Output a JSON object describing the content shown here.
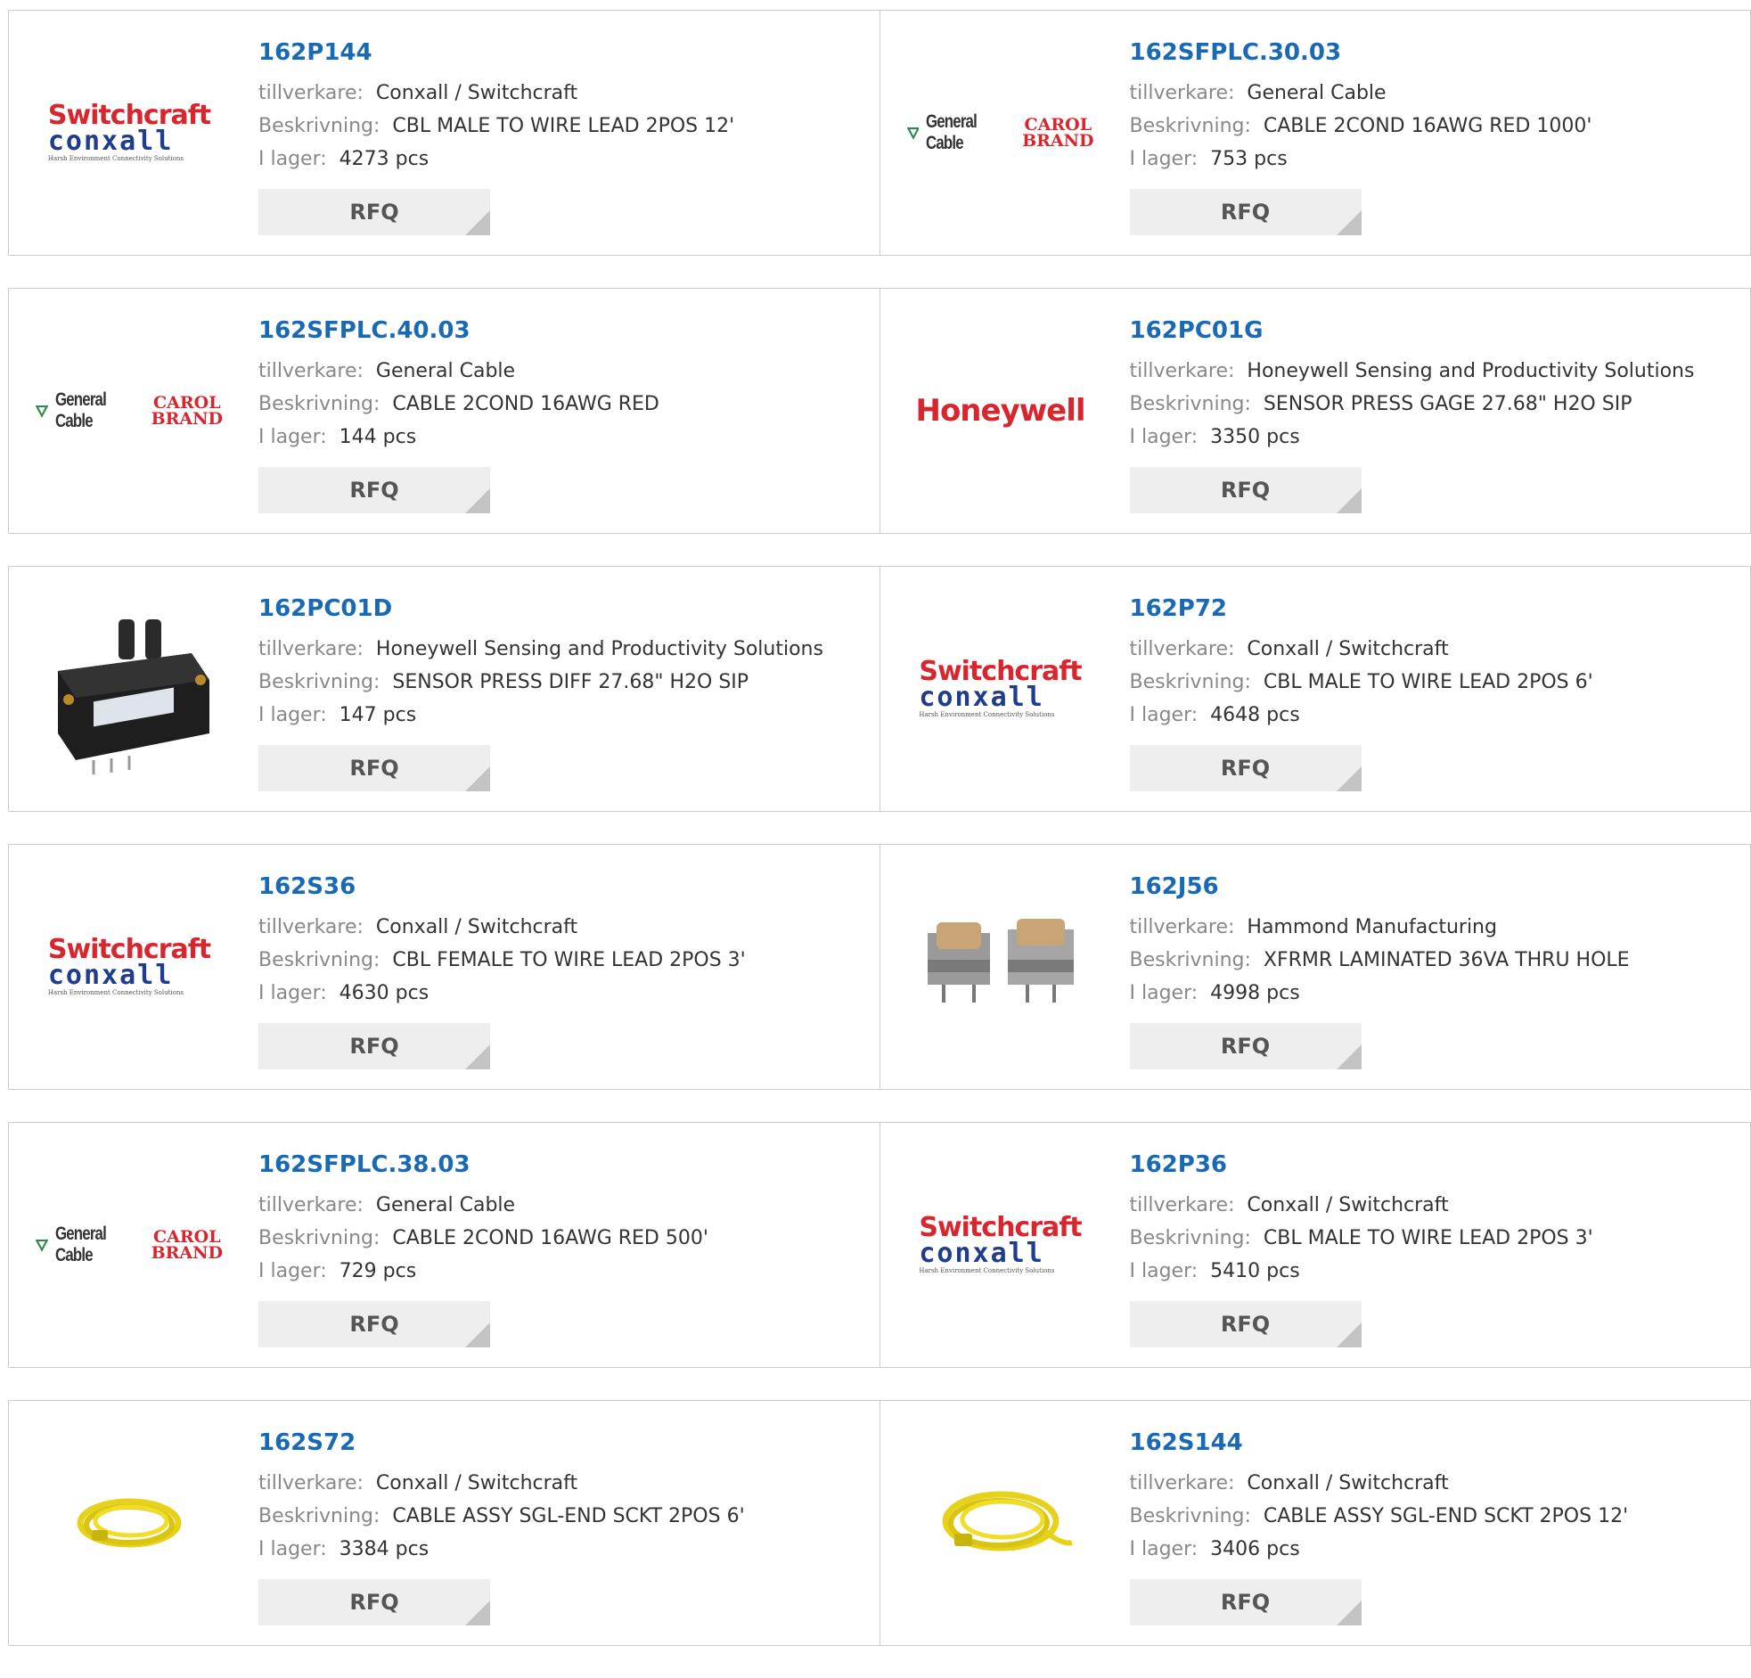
{
  "labels": {
    "manufacturer": "tillverkare:",
    "description": "Beskrivning:",
    "stock": "I lager:",
    "rfq": "RFQ"
  },
  "logos": {
    "switchcraft_top": "Switchcraft",
    "switchcraft_bottom": "conxall",
    "switchcraft_sub": "Harsh Environment Connectivity Solutions",
    "general_cable": "General Cable",
    "carol_line1": "CAROL",
    "carol_line2": "BRAND",
    "honeywell": "Honeywell"
  },
  "colors": {
    "link": "#1a69b4",
    "label": "#888888",
    "brand_red": "#d8262e",
    "brand_blue": "#1f3d8c",
    "button_bg": "#eeeeee"
  },
  "products": [
    {
      "part": "162P144",
      "manufacturer": "Conxall / Switchcraft",
      "description": "CBL MALE TO WIRE LEAD 2POS 12'",
      "stock": "4273 pcs",
      "image": "switchcraft-logo"
    },
    {
      "part": "162SFPLC.30.03",
      "manufacturer": "General Cable",
      "description": "CABLE 2COND 16AWG RED 1000'",
      "stock": "753 pcs",
      "image": "general-cable-logo"
    },
    {
      "part": "162SFPLC.40.03",
      "manufacturer": "General Cable",
      "description": "CABLE 2COND 16AWG RED",
      "stock": "144 pcs",
      "image": "general-cable-logo"
    },
    {
      "part": "162PC01G",
      "manufacturer": "Honeywell Sensing and Productivity Solutions",
      "description": "SENSOR PRESS GAGE 27.68\" H2O SIP",
      "stock": "3350 pcs",
      "image": "honeywell-logo"
    },
    {
      "part": "162PC01D",
      "manufacturer": "Honeywell Sensing and Productivity Solutions",
      "description": "SENSOR PRESS DIFF 27.68\" H2O SIP",
      "stock": "147 pcs",
      "image": "pressure-sensor-photo"
    },
    {
      "part": "162P72",
      "manufacturer": "Conxall / Switchcraft",
      "description": "CBL MALE TO WIRE LEAD 2POS 6'",
      "stock": "4648 pcs",
      "image": "switchcraft-logo"
    },
    {
      "part": "162S36",
      "manufacturer": "Conxall / Switchcraft",
      "description": "CBL FEMALE TO WIRE LEAD 2POS 3'",
      "stock": "4630 pcs",
      "image": "switchcraft-logo"
    },
    {
      "part": "162J56",
      "manufacturer": "Hammond Manufacturing",
      "description": "XFRMR LAMINATED 36VA THRU HOLE",
      "stock": "4998 pcs",
      "image": "transformer-photo"
    },
    {
      "part": "162SFPLC.38.03",
      "manufacturer": "General Cable",
      "description": "CABLE 2COND 16AWG RED 500'",
      "stock": "729 pcs",
      "image": "general-cable-logo"
    },
    {
      "part": "162P36",
      "manufacturer": "Conxall / Switchcraft",
      "description": "CBL MALE TO WIRE LEAD 2POS 3'",
      "stock": "5410 pcs",
      "image": "switchcraft-logo"
    },
    {
      "part": "162S72",
      "manufacturer": "Conxall / Switchcraft",
      "description": "CABLE ASSY SGL-END SCKT 2POS 6'",
      "stock": "3384 pcs",
      "image": "yellow-cable-photo"
    },
    {
      "part": "162S144",
      "manufacturer": "Conxall / Switchcraft",
      "description": "CABLE ASSY SGL-END SCKT 2POS 12'",
      "stock": "3406 pcs",
      "image": "yellow-cable-photo"
    }
  ]
}
